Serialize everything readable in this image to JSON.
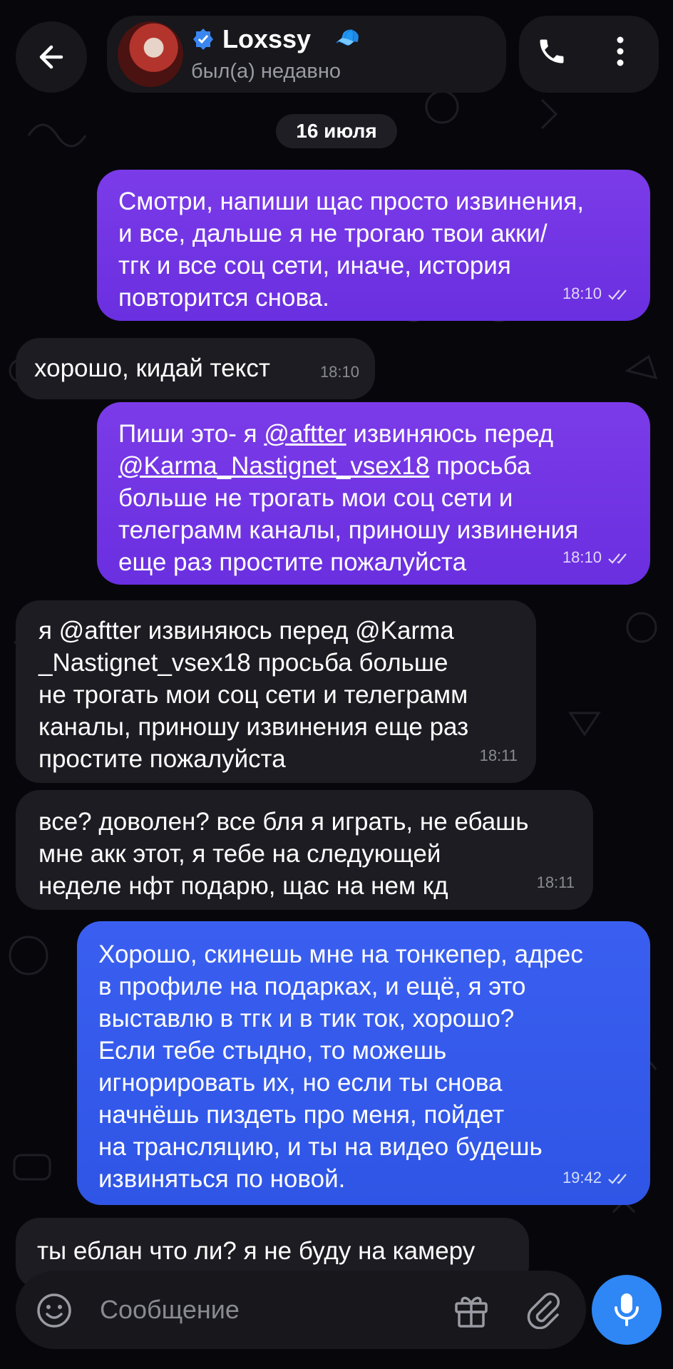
{
  "header": {
    "back": "back",
    "name": "Loxssy",
    "status": "был(а) недавно",
    "icons": [
      "arrow-left-icon",
      "verified-icon",
      "phone-icon",
      "more-vertical-icon"
    ]
  },
  "date_chip": "16 июля",
  "messages": [
    {
      "dir": "out",
      "text": "Смотри, напиши щас просто извинения,\nи все, дальше я не трогаю твои акки/\nтгк и все соц сети, иначе, история\nповторится снова.",
      "time": "18:10"
    },
    {
      "dir": "in",
      "text": "хорошо, кидай текст",
      "time": "18:10"
    },
    {
      "dir": "out",
      "text_parts": [
        "Пиши это- я ",
        "@aftter",
        " извиняюсь перед\n",
        "@Karma_Nastignet_vsex18",
        " просьба\nбольше не трогать мои соц сети и\nтелеграмм каналы, приношу извинения\nеще раз простите пожалуйста"
      ],
      "time": "18:10"
    },
    {
      "dir": "in",
      "text": "я @aftter извиняюсь перед @Karma\n_Nastignet_vsex18 просьба больше\nне трогать мои соц сети и телеграмм\nканалы, приношу извинения еще раз\nпростите пожалуйста",
      "time": "18:11"
    },
    {
      "dir": "in",
      "text": "все? доволен? все бля я играть, не ебашь\nмне акк этот, я тебе на следующей\nнеделе нфт подарю, щас на нем кд",
      "time": "18:11"
    },
    {
      "dir": "out",
      "text": "Хорошо, скинешь мне на тонкепер, адрес\nв профиле на подарках, и ещё, я это\nвыставлю в тгк и в тик ток, хорошо?\nЕсли тебе стыдно, то можешь\nигнорировать их, но если ты снова\nначнёшь пиздеть про меня, пойдет\nна трансляцию, и ты на видео будешь\nизвиняться по новой.",
      "time": "19:42"
    },
    {
      "dir": "in",
      "text": "ты еблан что ли? я не буду на камеру",
      "time": ""
    }
  ],
  "composer": {
    "placeholder": "Сообщение",
    "icons": [
      "emoji-icon",
      "gift-icon",
      "paperclip-icon",
      "microphone-icon"
    ]
  },
  "colors": {
    "background": "#07070b",
    "incoming": "#1c1c22",
    "outgoing": "#6f33e4",
    "outgoing_last": "#3359ec",
    "mic": "#2f86f5"
  }
}
